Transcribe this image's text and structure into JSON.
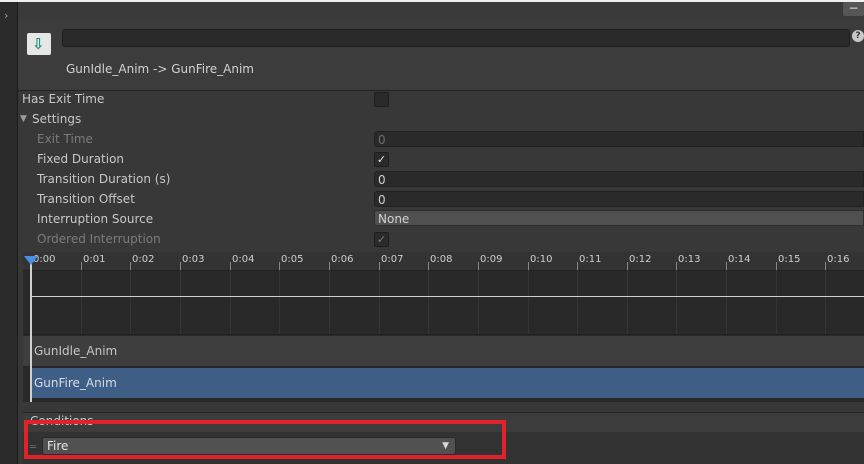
{
  "window": {
    "minimize_label": "−",
    "collapse_arrow": "›",
    "help_label": "?"
  },
  "header": {
    "transition_title": "GunIdle_Anim -> GunFire_Anim",
    "name_value": ""
  },
  "properties": {
    "has_exit_time": {
      "label": "Has Exit Time",
      "checked": false
    },
    "settings": {
      "label": "Settings",
      "exit_time": {
        "label": "Exit Time",
        "value": "0"
      },
      "fixed_duration": {
        "label": "Fixed Duration",
        "checked": true
      },
      "transition_duration": {
        "label": "Transition Duration (s)",
        "value": "0"
      },
      "transition_offset": {
        "label": "Transition Offset",
        "value": "0"
      },
      "interruption_source": {
        "label": "Interruption Source",
        "value": "None"
      },
      "ordered_interruption": {
        "label": "Ordered Interruption",
        "checked": true
      }
    }
  },
  "timeline": {
    "ticks": [
      "0:00",
      "0:01",
      "0:02",
      "0:03",
      "0:04",
      "0:05",
      "0:06",
      "0:07",
      "0:08",
      "0:09",
      "0:10",
      "0:11",
      "0:12",
      "0:13",
      "0:14",
      "0:15",
      "0:16"
    ],
    "tracks": {
      "source": "GunIdle_Anim",
      "destination": "GunFire_Anim"
    }
  },
  "conditions": {
    "title": "Conditions",
    "items": [
      {
        "parameter": "Fire"
      }
    ]
  },
  "colors": {
    "highlight": "#e2222a",
    "destination_bar": "#3e5e86",
    "playhead_marker": "#4a8fe0"
  }
}
